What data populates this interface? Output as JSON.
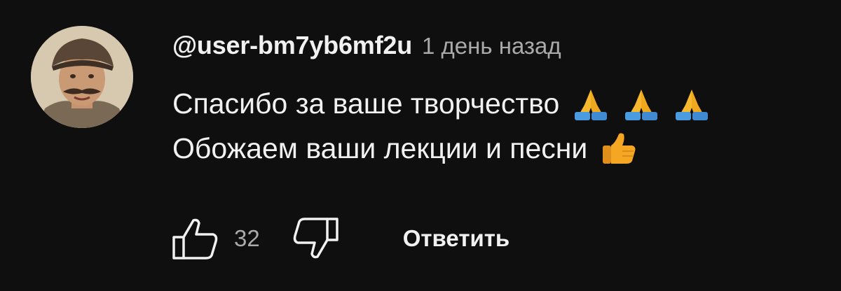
{
  "comment": {
    "author": "@user-bm7yb6mf2u",
    "timestamp": "1 день назад",
    "lines": [
      {
        "text": "Спасибо за ваше творчество",
        "emoji": [
          "folded-hands",
          "folded-hands",
          "folded-hands"
        ]
      },
      {
        "text": "Обожаем ваши лекции и песни",
        "emoji": [
          "thumbs-up"
        ]
      }
    ],
    "like_count": "32",
    "reply_label": "Ответить"
  },
  "icons": {
    "like": "thumbs-up-outline-icon",
    "dislike": "thumbs-down-outline-icon"
  },
  "colors": {
    "background": "#0f0f0f",
    "text_primary": "#f1f1f1",
    "text_secondary": "#aaaaaa"
  }
}
